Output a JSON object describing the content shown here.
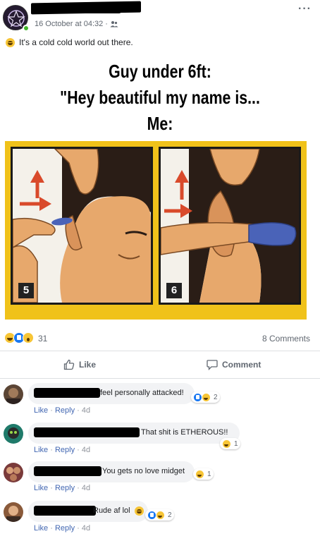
{
  "post": {
    "timestamp": "16 October at 04:32",
    "audience_icon": "friends-icon",
    "more_label": "···",
    "feeling_icon": "laughing-emoji-icon",
    "status_text": "It's a cold cold world out there."
  },
  "meme": {
    "caption_line1": "Guy under 6ft:",
    "caption_line2": "\"Hey beautiful my name is...",
    "caption_line3": "Me:",
    "panel_left_number": "5",
    "panel_right_number": "6",
    "frame_color": "#f0c21a"
  },
  "reactions": {
    "icons": [
      "haha-icon",
      "like-icon",
      "wow-icon"
    ],
    "count": "31",
    "comments_label": "8 Comments"
  },
  "actions": {
    "like_label": "Like",
    "comment_label": "Comment"
  },
  "comments": [
    {
      "text": "feel personally attacked!",
      "reaction_icons": [
        "like-icon",
        "haha-icon"
      ],
      "reaction_count": "2",
      "like": "Like",
      "reply": "Reply",
      "age": "4d"
    },
    {
      "text": "That shit is ETHEROUS!!",
      "reaction_icons": [
        "haha-icon"
      ],
      "reaction_count": "1",
      "like": "Like",
      "reply": "Reply",
      "age": "4d"
    },
    {
      "text": "You gets no love midget",
      "reaction_icons": [
        "haha-icon"
      ],
      "reaction_count": "1",
      "like": "Like",
      "reply": "Reply",
      "age": "4d"
    },
    {
      "text": "Rude af lol",
      "reaction_icons": [
        "like-icon",
        "haha-icon"
      ],
      "reaction_count": "2",
      "like": "Like",
      "reply": "Reply",
      "age": "4d"
    }
  ],
  "colors": {
    "link_blue": "#4267b2",
    "meta_gray": "#606770",
    "like_blue": "#1877f2",
    "haha_yellow": "#f7c536"
  }
}
